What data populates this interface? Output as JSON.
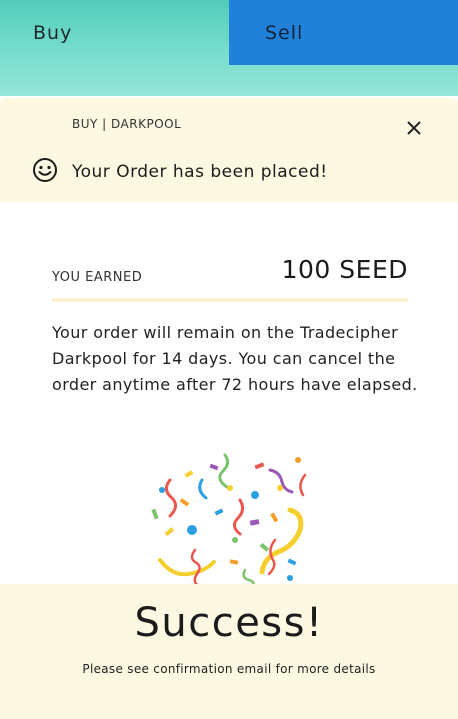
{
  "tabs": {
    "buy_label": "Buy",
    "sell_label": "Sell",
    "active": "Sell"
  },
  "modal": {
    "breadcrumb": "BUY | DARKPOOL",
    "status_message": "Your Order has been placed!",
    "earned_label": "YOU EARNED",
    "earned_value": "100 SEED",
    "note": "Your order will remain on the Tradecipher Darkpool for 14 days. You can cancel the order anytime after 72 hours have elapsed.",
    "success_title": "Success!",
    "footer_note": "Please see confirmation email for more details"
  },
  "icons": {
    "close": "close-icon",
    "status": "smile-icon",
    "celebration": "confetti-icon"
  },
  "colors": {
    "tab_gradient_top": "#52cbb9",
    "tab_gradient_bottom": "#95e6d8",
    "sell_tab": "#2181d9",
    "cream": "#fdf8e2"
  }
}
